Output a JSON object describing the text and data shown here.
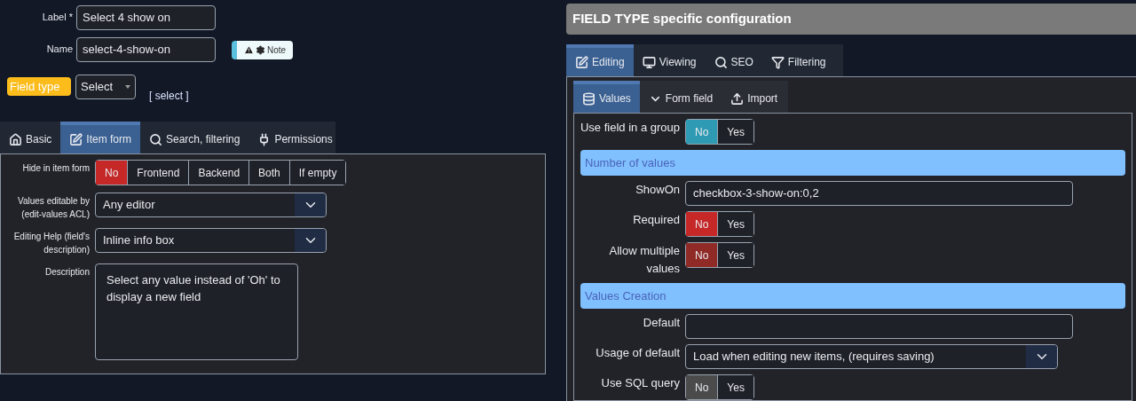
{
  "top_fields": [
    {
      "label": "Label *",
      "value": "Select 4 show on"
    },
    {
      "label": "Name",
      "value": "select-4-show-on",
      "note": {
        "label": "Note"
      }
    }
  ],
  "field_type": {
    "badge": "Field type",
    "value": "Select",
    "code": "[ select ]"
  },
  "left_tabs": [
    {
      "label": "Basic",
      "selected": false
    },
    {
      "label": "Item form",
      "selected": true
    },
    {
      "label": "Search, filtering",
      "selected": false
    },
    {
      "label": "Permissions",
      "selected": false
    }
  ],
  "left_rows": [
    {
      "kind": "toggle",
      "label": "Hide in item form",
      "color": "#c62828",
      "options": [
        {
          "label": "No",
          "selected": true
        },
        {
          "label": "Frontend",
          "selected": false
        },
        {
          "label": "Backend",
          "selected": false
        },
        {
          "label": "Both",
          "selected": false
        },
        {
          "label": "If empty",
          "selected": false
        }
      ]
    },
    {
      "kind": "select",
      "label": "Values editable by (edit-values ACL)",
      "value": "Any editor"
    },
    {
      "kind": "select",
      "label": "Editing Help (field's description)",
      "value": "Inline info box"
    },
    {
      "kind": "textarea",
      "label": "Description",
      "value": "Select any value instead of 'Oh' to display a new field"
    }
  ],
  "config": {
    "title": "FIELD TYPE specific configuration",
    "tabs": [
      {
        "label": "Editing",
        "selected": true
      },
      {
        "label": "Viewing",
        "selected": false
      },
      {
        "label": "SEO",
        "selected": false
      },
      {
        "label": "Filtering",
        "selected": false
      }
    ],
    "subtabs": [
      {
        "label": "Values",
        "selected": true
      },
      {
        "label": "Form field",
        "selected": false
      },
      {
        "label": "Import",
        "selected": false
      }
    ],
    "rows": [
      {
        "kind": "toggle",
        "label": "Use field in a group",
        "color": "#2f9ab3",
        "options": [
          {
            "label": "No",
            "selected": true
          },
          {
            "label": "Yes",
            "selected": false
          }
        ]
      },
      {
        "kind": "section",
        "label": "Number of values"
      },
      {
        "kind": "input",
        "label": "ShowOn",
        "value": "checkbox-3-show-on:0,2"
      },
      {
        "kind": "toggle",
        "label": "Required",
        "color": "#c62828",
        "options": [
          {
            "label": "No",
            "selected": true
          },
          {
            "label": "Yes",
            "selected": false
          }
        ]
      },
      {
        "kind": "toggle",
        "label": "Allow multiple values",
        "color": "#8f2a26",
        "options": [
          {
            "label": "No",
            "selected": true
          },
          {
            "label": "Yes",
            "selected": false
          }
        ]
      },
      {
        "kind": "section",
        "label": "Values Creation"
      },
      {
        "kind": "input",
        "label": "Default"
      },
      {
        "kind": "select",
        "label": "Usage of default",
        "value": "Load when editing new items, (requires saving)"
      },
      {
        "kind": "toggle",
        "label": "Use SQL query",
        "color": "#4b4b4b",
        "options": [
          {
            "label": "No",
            "selected": true
          },
          {
            "label": "Yes",
            "selected": false
          }
        ]
      }
    ]
  }
}
